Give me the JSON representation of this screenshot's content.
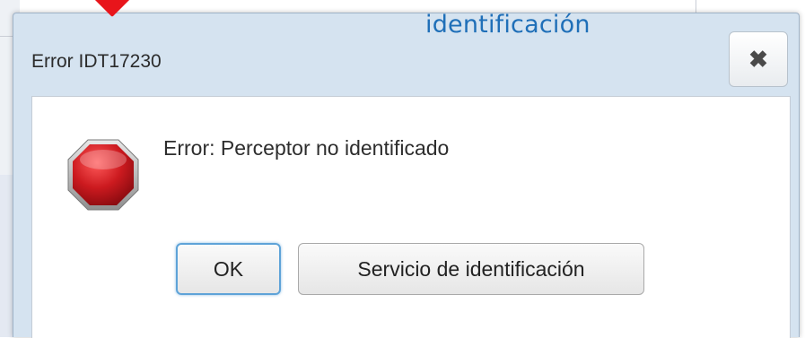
{
  "annotation": {
    "text": "identificación",
    "color": "#1f6fb8"
  },
  "dialog": {
    "title": "Error IDT17230",
    "close_icon": "close-icon",
    "message": "Error: Perceptor no identificado",
    "status_icon": "stop-icon",
    "buttons": {
      "ok_label": "OK",
      "service_label": "Servicio de identificación"
    }
  },
  "colors": {
    "titlebar": "#d5e3f0",
    "stop_red": "#c3141b",
    "focus_border": "#5ea3d8",
    "pointer_arrow": "#e8151b"
  }
}
